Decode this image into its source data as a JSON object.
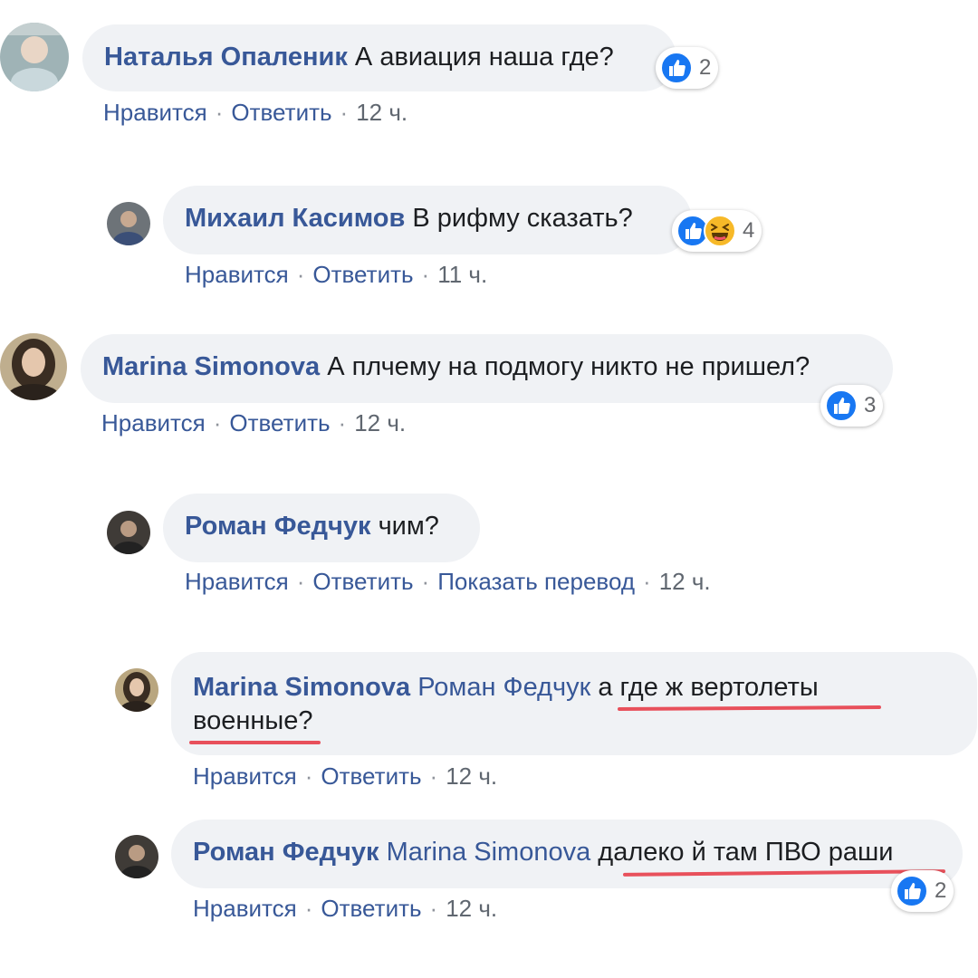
{
  "comments": [
    {
      "author": "Наталья Опаленик",
      "text": "А авиация наша где?",
      "actions": {
        "like": "Нравится",
        "reply": "Ответить",
        "time": "12 ч."
      },
      "reactions": {
        "count": "2",
        "icons": [
          "like-icon"
        ]
      }
    },
    {
      "author": "Михаил Касимов",
      "text": "В рифму сказать?",
      "actions": {
        "like": "Нравится",
        "reply": "Ответить",
        "time": "11 ч."
      },
      "reactions": {
        "count": "4",
        "icons": [
          "like-icon",
          "haha-icon"
        ]
      }
    },
    {
      "author": "Marina Simonova",
      "text": "А плчему на подмогу никто не пришел?",
      "actions": {
        "like": "Нравится",
        "reply": "Ответить",
        "time": "12 ч."
      },
      "reactions": {
        "count": "3",
        "icons": [
          "like-icon"
        ]
      }
    },
    {
      "author": "Роман Федчук",
      "text": "чим?",
      "actions": {
        "like": "Нравится",
        "reply": "Ответить",
        "translate": "Показать перевод",
        "time": "12 ч."
      }
    },
    {
      "author": "Marina Simonova",
      "mention": "Роман Федчук",
      "text_line1": "а где ж вертолеты",
      "text_line2": "военные?",
      "actions": {
        "like": "Нравится",
        "reply": "Ответить",
        "time": "12 ч."
      }
    },
    {
      "author": "Роман Федчук",
      "mention": "Marina Simonova",
      "text": "далеко й там ПВО раши",
      "actions": {
        "like": "Нравится",
        "reply": "Ответить",
        "time": "12 ч."
      },
      "reactions": {
        "count": "2",
        "icons": [
          "like-icon"
        ]
      }
    }
  ],
  "separator": "·",
  "colors": {
    "author": "#385898",
    "bubble": "#f0f2f5",
    "like_blue": "#1877f2",
    "haha_yellow": "#f7b928",
    "highlight_underline": "#e8505b"
  }
}
